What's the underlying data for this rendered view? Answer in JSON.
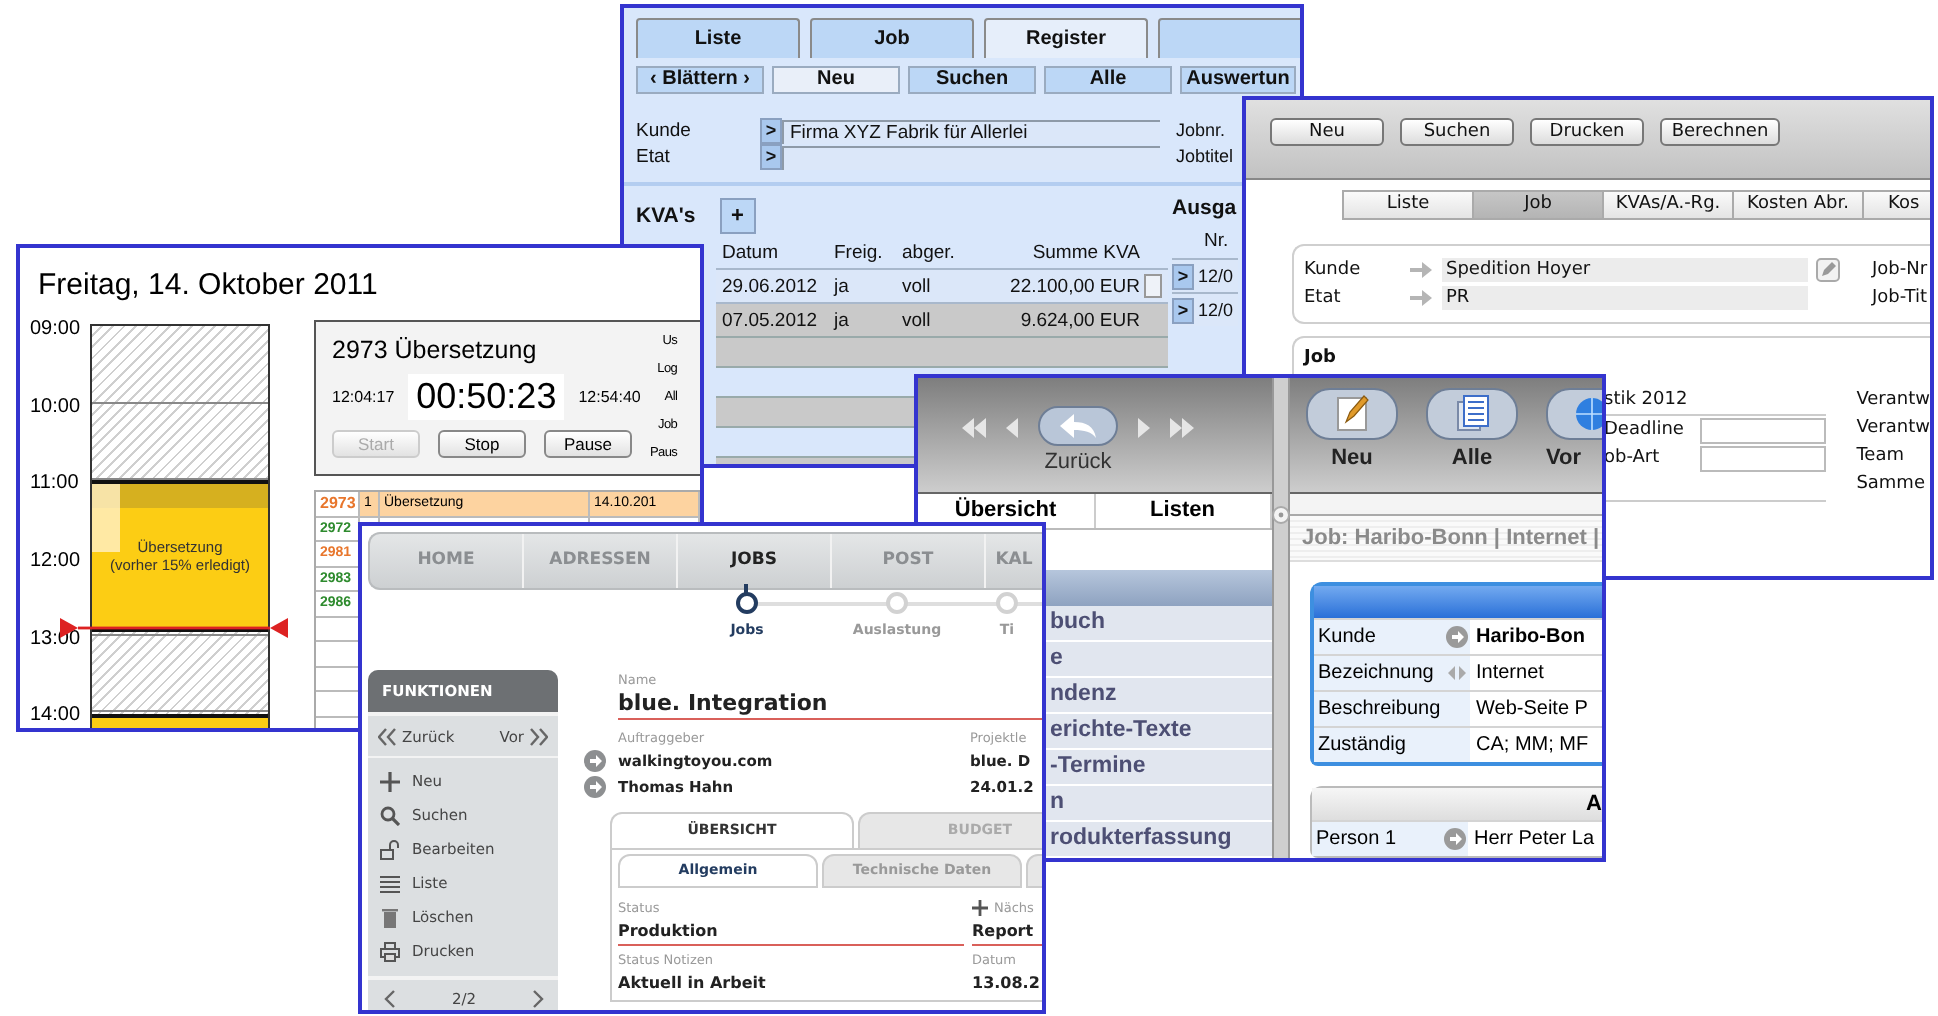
{
  "windows": [
    {
      "kind": "register",
      "tabs": [
        {
          "label": "Liste",
          "selected": false
        },
        {
          "label": "Job",
          "selected": false
        },
        {
          "label": "Register",
          "selected": true
        }
      ],
      "buttons": [
        {
          "label": "‹ Blättern ›",
          "selected": false
        },
        {
          "label": "Neu",
          "selected": true
        },
        {
          "label": "Suchen",
          "selected": false
        },
        {
          "label": "Alle",
          "selected": false
        },
        {
          "label": "Auswertun",
          "selected": false
        }
      ],
      "fields": [
        {
          "label": "Kunde",
          "arrow": ">",
          "value": "Firma XYZ Fabrik für Allerlei"
        },
        {
          "label": "Etat",
          "arrow": ">"
        }
      ],
      "side_labels": [
        "Jobnr.",
        "Jobtitel"
      ],
      "kva": {
        "title": "KVA's",
        "add": "+",
        "columns": [
          "Datum",
          "Freig.",
          "abger.",
          "Summe KVA"
        ],
        "rows": [
          {
            "cells": [
              "29.06.2012",
              "ja",
              "voll",
              "22.100,00 EUR"
            ],
            "selected": false
          },
          {
            "cells": [
              "07.05.2012",
              "ja",
              "voll",
              "9.624,00 EUR"
            ],
            "selected": true
          }
        ]
      },
      "ausgaben": {
        "title": "Ausga",
        "column": "Nr.",
        "rows": [
          {
            "arrow": ">",
            "value": "12/0"
          },
          {
            "arrow": ">",
            "value": "12/0"
          }
        ]
      }
    },
    {
      "kind": "job_form",
      "buttons": [
        "Neu",
        "Suchen",
        "Drucken",
        "Berechnen"
      ],
      "tabs": [
        {
          "label": "Liste",
          "selected": false
        },
        {
          "label": "Job",
          "selected": true
        },
        {
          "label": "KVAs/A.-Rg.",
          "selected": false
        },
        {
          "label": "Kosten Abr.",
          "selected": false
        },
        {
          "label": "Kos",
          "selected": false
        }
      ],
      "fields": [
        {
          "label": "Kunde",
          "value": "Spedition Hoyer",
          "editable": true
        },
        {
          "label": "Etat",
          "value": "PR",
          "editable": false
        }
      ],
      "side_labels": [
        "Job-Nr",
        "Job-Tit"
      ],
      "section": {
        "title": "Job",
        "rows": [
          {
            "kind": "text",
            "label": "stik 2012"
          },
          {
            "kind": "field",
            "label": "Deadline"
          },
          {
            "kind": "field",
            "label": "ob-Art"
          }
        ],
        "side_labels": [
          "Verantw",
          "Verantw",
          "Team",
          "Samme"
        ]
      }
    },
    {
      "kind": "calendar",
      "date": "Freitag, 14. Oktober 2011",
      "hours": [
        "09:00",
        "10:00",
        "11:00",
        "12:00",
        "13:00",
        "14:00"
      ],
      "events": [
        {
          "kind": "active",
          "title": "Übersetzung",
          "note": "(vorher 15% erledigt)"
        },
        {
          "kind": "upcoming"
        }
      ],
      "timer": {
        "title": "2973 Übersetzung",
        "start": "12:04:17",
        "elapsed": "00:50:23",
        "end": "12:54:40",
        "buttons": [
          {
            "label": "Start",
            "disabled": true
          },
          {
            "label": "Stop",
            "disabled": false
          },
          {
            "label": "Pause",
            "disabled": false
          }
        ],
        "side_labels": [
          "Us",
          "Log",
          "All",
          "Job",
          "Paus"
        ]
      },
      "tasks": [
        {
          "id": "2973",
          "color": "#e8762c",
          "selected": true,
          "cells": [
            "1",
            "Übersetzung",
            "14.10.201"
          ]
        },
        {
          "id": "2972",
          "color": "#2e8b2e",
          "selected": false
        },
        {
          "id": "2981",
          "color": "#e8762c",
          "selected": false
        },
        {
          "id": "2983",
          "color": "#2e8b2e",
          "selected": false
        },
        {
          "id": "2986",
          "color": "#2e8b2e",
          "selected": false
        }
      ]
    },
    {
      "kind": "ipad",
      "left": {
        "nav_label": "Zurück",
        "tabs": [
          "Übersicht",
          "Listen"
        ],
        "items": [
          "buch",
          "e",
          "ndenz",
          "erichte-Texte",
          "-Termine",
          "n",
          "rodukterfassung"
        ]
      },
      "right": {
        "buttons": [
          {
            "kind": "pencil",
            "label": "Neu"
          },
          {
            "kind": "list",
            "label": "Alle"
          },
          {
            "kind": "globe",
            "label": "Vor"
          }
        ],
        "breadcrumb": "Job: Haribo-Bonn | Internet |",
        "card": [
          {
            "kind": "arrow",
            "label": "Kunde",
            "value": "Haribo-Bon",
            "bold": true
          },
          {
            "kind": "split",
            "label": "Bezeichnung",
            "value": "Internet",
            "bold": false
          },
          {
            "kind": "plain",
            "label": "Beschreibung",
            "value": "Web-Seite P",
            "bold": false
          },
          {
            "kind": "plain",
            "label": "Zuständig",
            "value": "CA; MM; MF",
            "bold": false
          }
        ],
        "card2": {
          "title": "A",
          "rows": [
            {
              "kind": "arrow",
              "label": "Person 1",
              "value": "Herr Peter La",
              "bold": false
            }
          ]
        }
      }
    },
    {
      "kind": "web_app",
      "nav": [
        {
          "label": "HOME",
          "selected": false
        },
        {
          "label": "ADRESSEN",
          "selected": false
        },
        {
          "label": "JOBS",
          "selected": true
        },
        {
          "label": "POST",
          "selected": false
        },
        {
          "label": "KAL",
          "selected": false
        }
      ],
      "steps": [
        {
          "label": "Jobs",
          "selected": true
        },
        {
          "label": "Auslastung",
          "selected": false
        },
        {
          "label": "Ti",
          "selected": false
        }
      ],
      "sidebar": {
        "title": "FUNKTIONEN",
        "back": "Zurück",
        "forward": "Vor",
        "items": [
          {
            "kind": "plus",
            "label": "Neu"
          },
          {
            "kind": "search",
            "label": "Suchen"
          },
          {
            "kind": "lock",
            "label": "Bearbeiten"
          },
          {
            "kind": "list",
            "label": "Liste"
          },
          {
            "kind": "trash",
            "label": "Löschen"
          },
          {
            "kind": "print",
            "label": "Drucken"
          }
        ],
        "pager": "2/2"
      },
      "name_label": "Name",
      "name": "blue. Integration",
      "client": {
        "label": "Auftraggeber",
        "lines": [
          "walkingtoyou.com",
          "Thomas Hahn"
        ]
      },
      "project": {
        "label": "Projektle",
        "lines": [
          "blue. D",
          "24.01.2"
        ]
      },
      "tabs": [
        {
          "label": "ÜBERSICHT",
          "selected": true
        },
        {
          "label": "BUDGET",
          "selected": false
        }
      ],
      "subtabs": [
        {
          "label": "Allgemein",
          "selected": true
        },
        {
          "label": "Technische Daten",
          "selected": false
        }
      ],
      "fields": [
        {
          "label": "Status",
          "value": "Produktion",
          "underline": true
        },
        {
          "label": "Status Notizen",
          "value": "Aktuell in Arbeit",
          "underline": false
        }
      ],
      "side": {
        "action": "Nächs",
        "value": "Report",
        "label": "Datum",
        "date": "13.08.2"
      }
    }
  ]
}
